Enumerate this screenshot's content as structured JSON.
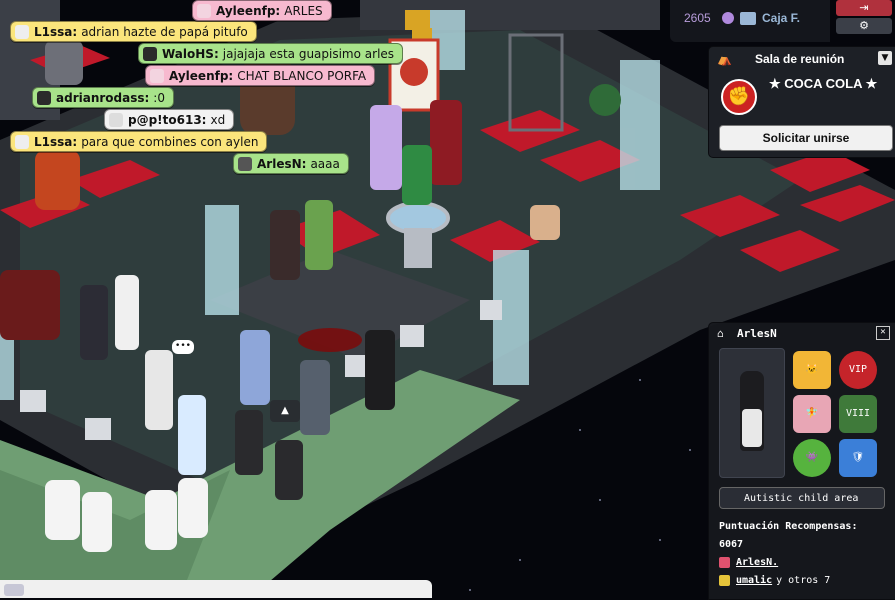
{
  "chat_messages": [
    {
      "name": "L1ssa:",
      "text": "adrian hazte de papá pitufo",
      "color": "yellow"
    },
    {
      "name": "Ayleenfp:",
      "text": "ARLES",
      "color": "pink"
    },
    {
      "name": "WaloHS:",
      "text": "jajajaja esta guapisimo arles",
      "color": "green"
    },
    {
      "name": "Ayleenfp:",
      "text": "CHAT BLANCO PORFA",
      "color": "pink"
    },
    {
      "name": "adrianrodass:",
      "text": ":0",
      "color": "green"
    },
    {
      "name": "p@p!to613:",
      "text": "xd",
      "color": "white"
    },
    {
      "name": "L1ssa:",
      "text": "para que combines con aylen",
      "color": "yellow"
    },
    {
      "name": "ArlesN:",
      "text": "aaaa",
      "color": "green"
    }
  ],
  "topbar": {
    "duckets": "2605",
    "caja_label": "Caja F.",
    "exit_icon": "exit-icon",
    "settings_icon": "gear-icon"
  },
  "group_panel": {
    "title": "Sala de reunión",
    "group_name": "★ COCA COLA ★",
    "join_button": "Solicitar unirse",
    "collapse_icon": "chevron-down-icon"
  },
  "user_panel": {
    "username": "ArlesN",
    "close_icon": "close-icon",
    "motto": "Autistic child area",
    "score_label": "Puntuación Recompensas:",
    "score_value": "6067",
    "relations": [
      {
        "icon": "heart-icon",
        "name": "ArlesN.",
        "extra": "",
        "color": "#e0526f"
      },
      {
        "icon": "smile-icon",
        "name": "umalic",
        "extra": "y otros 7",
        "color": "#e5c43a"
      }
    ],
    "badges": [
      "cat-badge",
      "vip-badge",
      "fairy-badge",
      "vii-badge",
      "monster-badge",
      "shield-badge"
    ]
  },
  "colors": {
    "floor_dark": "#2b2e33",
    "floor_tile": "#3d6a5e",
    "seat_red": "#c0192a",
    "space_bg": "#05060c",
    "grass": "#6f9e73"
  }
}
